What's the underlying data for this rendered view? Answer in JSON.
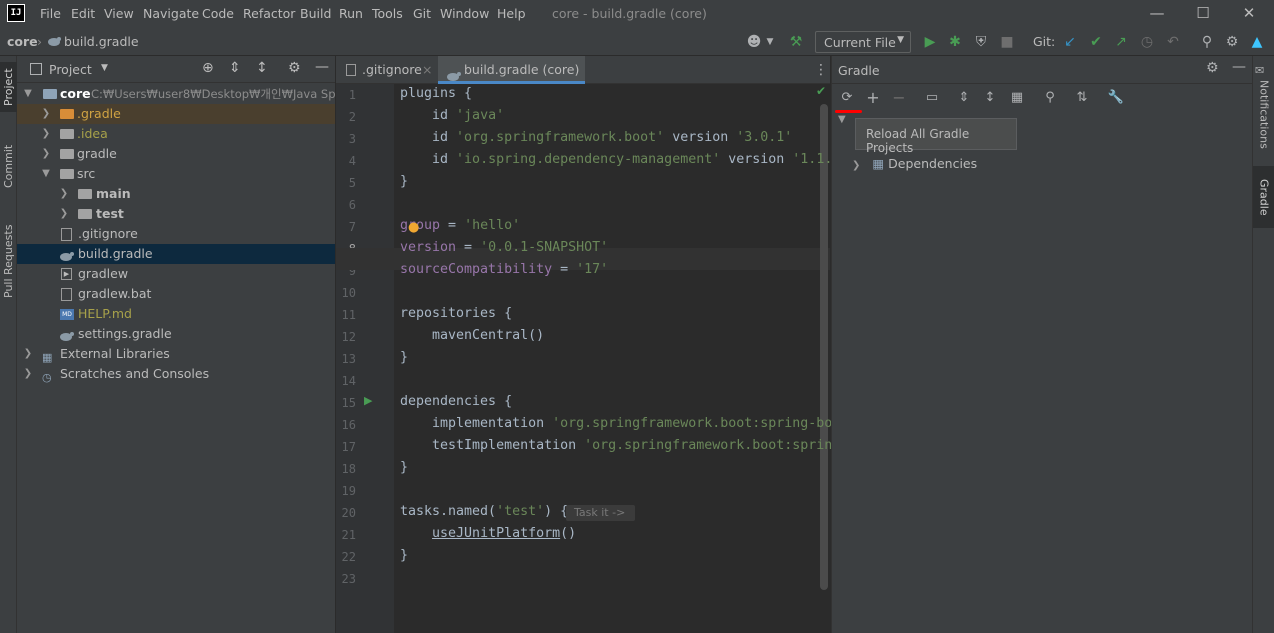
{
  "window": {
    "title": "core - build.gradle (core)",
    "logo": "IJ"
  },
  "menu": [
    "File",
    "Edit",
    "View",
    "Navigate",
    "Code",
    "Refactor",
    "Build",
    "Run",
    "Tools",
    "Git",
    "Window",
    "Help"
  ],
  "navbar": {
    "crumb1": "core",
    "crumb2": "build.gradle",
    "run_config": "Current File",
    "git_label": "Git:"
  },
  "left_strip": {
    "tab1": "Project",
    "tab2": "Commit",
    "tab3": "Pull Requests"
  },
  "project": {
    "title": "Project",
    "tree": [
      {
        "label": "core",
        "path": "C:₩Users₩user8₩Desktop₩개인₩Java Spring"
      },
      {
        "label": ".gradle"
      },
      {
        "label": ".idea"
      },
      {
        "label": "gradle"
      },
      {
        "label": "src"
      },
      {
        "label": "main"
      },
      {
        "label": "test"
      },
      {
        "label": ".gitignore"
      },
      {
        "label": "build.gradle"
      },
      {
        "label": "gradlew"
      },
      {
        "label": "gradlew.bat"
      },
      {
        "label": "HELP.md"
      },
      {
        "label": "settings.gradle"
      },
      {
        "label": "External Libraries"
      },
      {
        "label": "Scratches and Consoles"
      }
    ]
  },
  "editor": {
    "tabs": [
      {
        "label": ".gitignore"
      },
      {
        "label": "build.gradle (core)"
      }
    ],
    "current_line": 8,
    "inlay_hint": "Task it ->"
  },
  "gradle": {
    "title": "Gradle",
    "tooltip": "Reload All Gradle Projects",
    "tree_item": "Dependencies"
  },
  "right_strip": {
    "tab1": "Notifications",
    "tab2": "Gradle"
  },
  "colors": {
    "selection": "#0d293e",
    "string": "#6a8759",
    "keyword": "#cc7832",
    "underline": "#ff0000"
  }
}
